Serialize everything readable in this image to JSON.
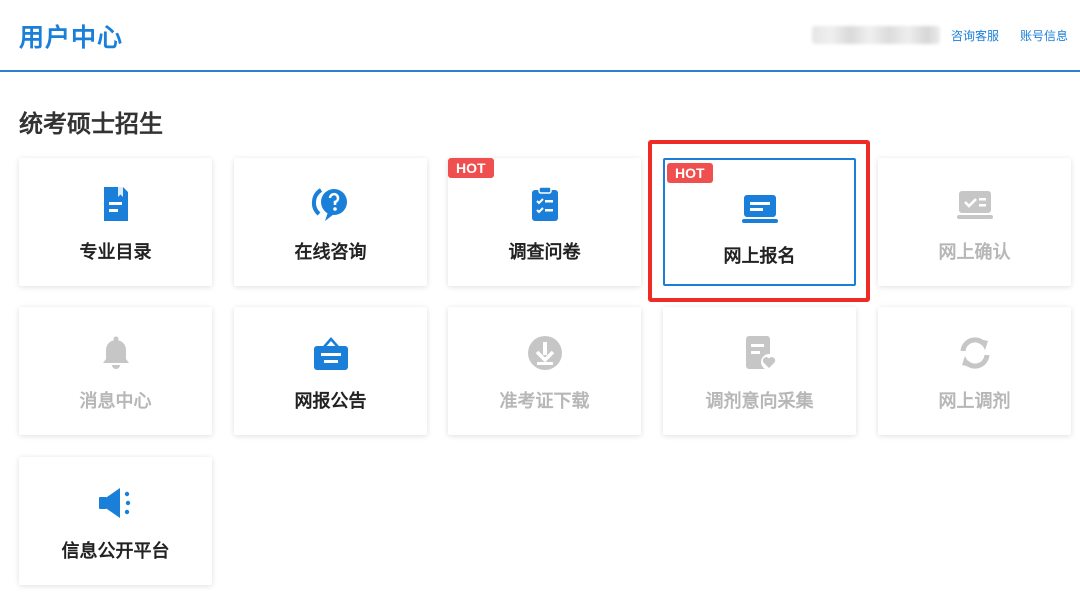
{
  "header": {
    "brand": "用户中心",
    "links": [
      "咨询客服",
      "账号信息"
    ]
  },
  "section": {
    "title": "统考硕士招生"
  },
  "hot_label": "HOT",
  "cards": [
    {
      "label": "专业目录",
      "icon": "document-bookmark-icon",
      "active": true,
      "hot": false
    },
    {
      "label": "在线咨询",
      "icon": "question-bubble-icon",
      "active": true,
      "hot": false
    },
    {
      "label": "调查问卷",
      "icon": "clipboard-checklist-icon",
      "active": true,
      "hot": true
    },
    {
      "label": "网上报名",
      "icon": "laptop-form-icon",
      "active": true,
      "hot": true,
      "selected": true
    },
    {
      "label": "网上确认",
      "icon": "id-card-check-icon",
      "active": false,
      "hot": false
    },
    {
      "label": "消息中心",
      "icon": "bell-icon",
      "active": false,
      "hot": false
    },
    {
      "label": "网报公告",
      "icon": "notice-bag-icon",
      "active": true,
      "hot": false
    },
    {
      "label": "准考证下载",
      "icon": "download-circle-icon",
      "active": false,
      "hot": false
    },
    {
      "label": "调剂意向采集",
      "icon": "document-heart-icon",
      "active": false,
      "hot": false
    },
    {
      "label": "网上调剂",
      "icon": "refresh-arrows-icon",
      "active": false,
      "hot": false
    },
    {
      "label": "信息公开平台",
      "icon": "megaphone-icon",
      "active": true,
      "hot": false
    }
  ],
  "colors": {
    "accent": "#1a7fd8",
    "disabled": "#b7b7b7",
    "hot": "#ef4f4f",
    "annotation": "#ee2b24"
  }
}
